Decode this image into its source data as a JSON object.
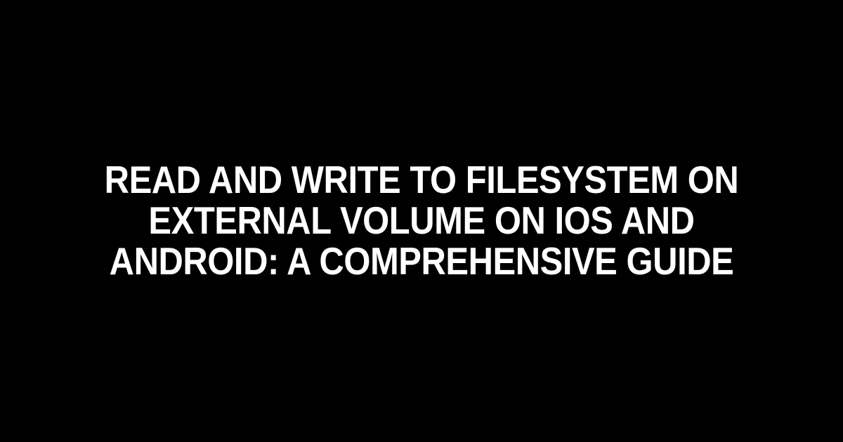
{
  "title": "Read and Write to Filesystem on External Volume on iOS and Android: A Comprehensive Guide"
}
